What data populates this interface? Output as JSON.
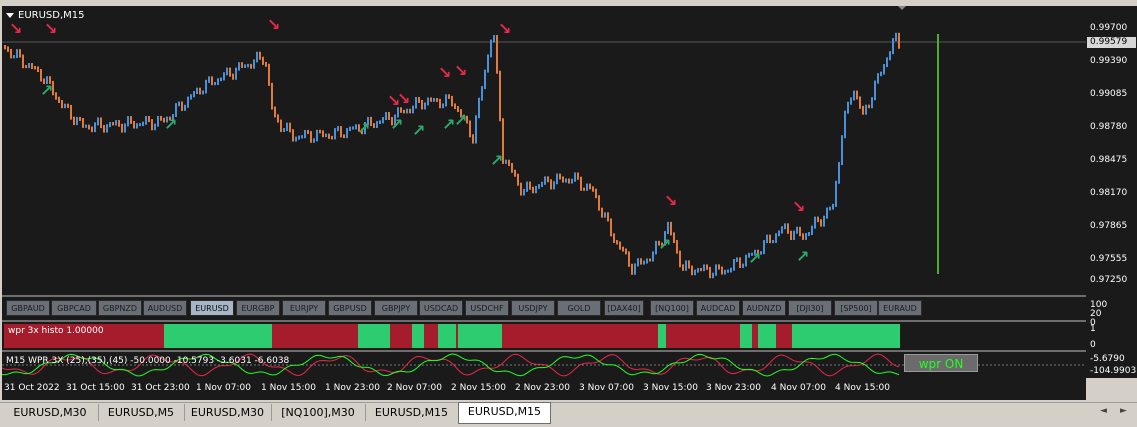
{
  "window": {
    "title": "EURUSD,M15"
  },
  "price_axis": {
    "labels": [
      "0.99700",
      "0.99390",
      "0.99085",
      "0.98780",
      "0.98475",
      "0.98170",
      "0.97865",
      "0.97555",
      "0.97250"
    ],
    "current_price": "0.99579"
  },
  "symbol_buttons": {
    "items": [
      "GBPAUD",
      "GBPCAD",
      "GBPNZD",
      "AUDUSD",
      "EURUSD",
      "EURGBP",
      "EURJPY",
      "GBPUSD",
      "GBPJPY",
      "USDCAD",
      "USDCHF",
      "USDJPY",
      "GOLD",
      "[DAX40]",
      "[NQ100]",
      "AUDCAD",
      "AUDNZD",
      "[DJI30]",
      "[SP500]",
      "EURAUD"
    ],
    "active": "EURUSD",
    "axis_top": "100",
    "axis_mid": "20",
    "axis_bot": "0"
  },
  "histo_panel": {
    "label": "wpr 3x histo 1.00000",
    "axis_top": "1",
    "axis_bot": "0",
    "colors": {
      "bull": "#2ecc71",
      "bear": "#a51d2d"
    }
  },
  "wpr_panel": {
    "label": "M15  WPR 3X (25),(35),(45) -50.0000 -10.5793 -3.6031 -6.6038",
    "axis_top": "-5.6790",
    "axis_bot": "-104.9903",
    "toggle_label": "wpr ON"
  },
  "time_axis": {
    "labels": [
      "31 Oct 2022",
      "31 Oct 15:00",
      "31 Oct 23:00",
      "1 Nov 07:00",
      "1 Nov 15:00",
      "1 Nov 23:00",
      "2 Nov 07:00",
      "2 Nov 15:00",
      "2 Nov 23:00",
      "3 Nov 07:00",
      "3 Nov 15:00",
      "3 Nov 23:00",
      "4 Nov 07:00",
      "4 Nov 15:00"
    ]
  },
  "tabs": {
    "items": [
      "EURUSD,M30",
      "EURUSD,M5",
      "EURUSD,M30",
      "[NQ100],M30",
      "EURUSD,M15",
      "EURUSD,M15"
    ],
    "active_index": 5
  },
  "colors": {
    "bg": "#1a1a1a",
    "up_bar": "#4a90d9",
    "down_bar": "#e07b39",
    "sell_arrow": "#e8284a",
    "buy_arrow": "#2ea86b",
    "vline": "#4caf2a"
  }
}
